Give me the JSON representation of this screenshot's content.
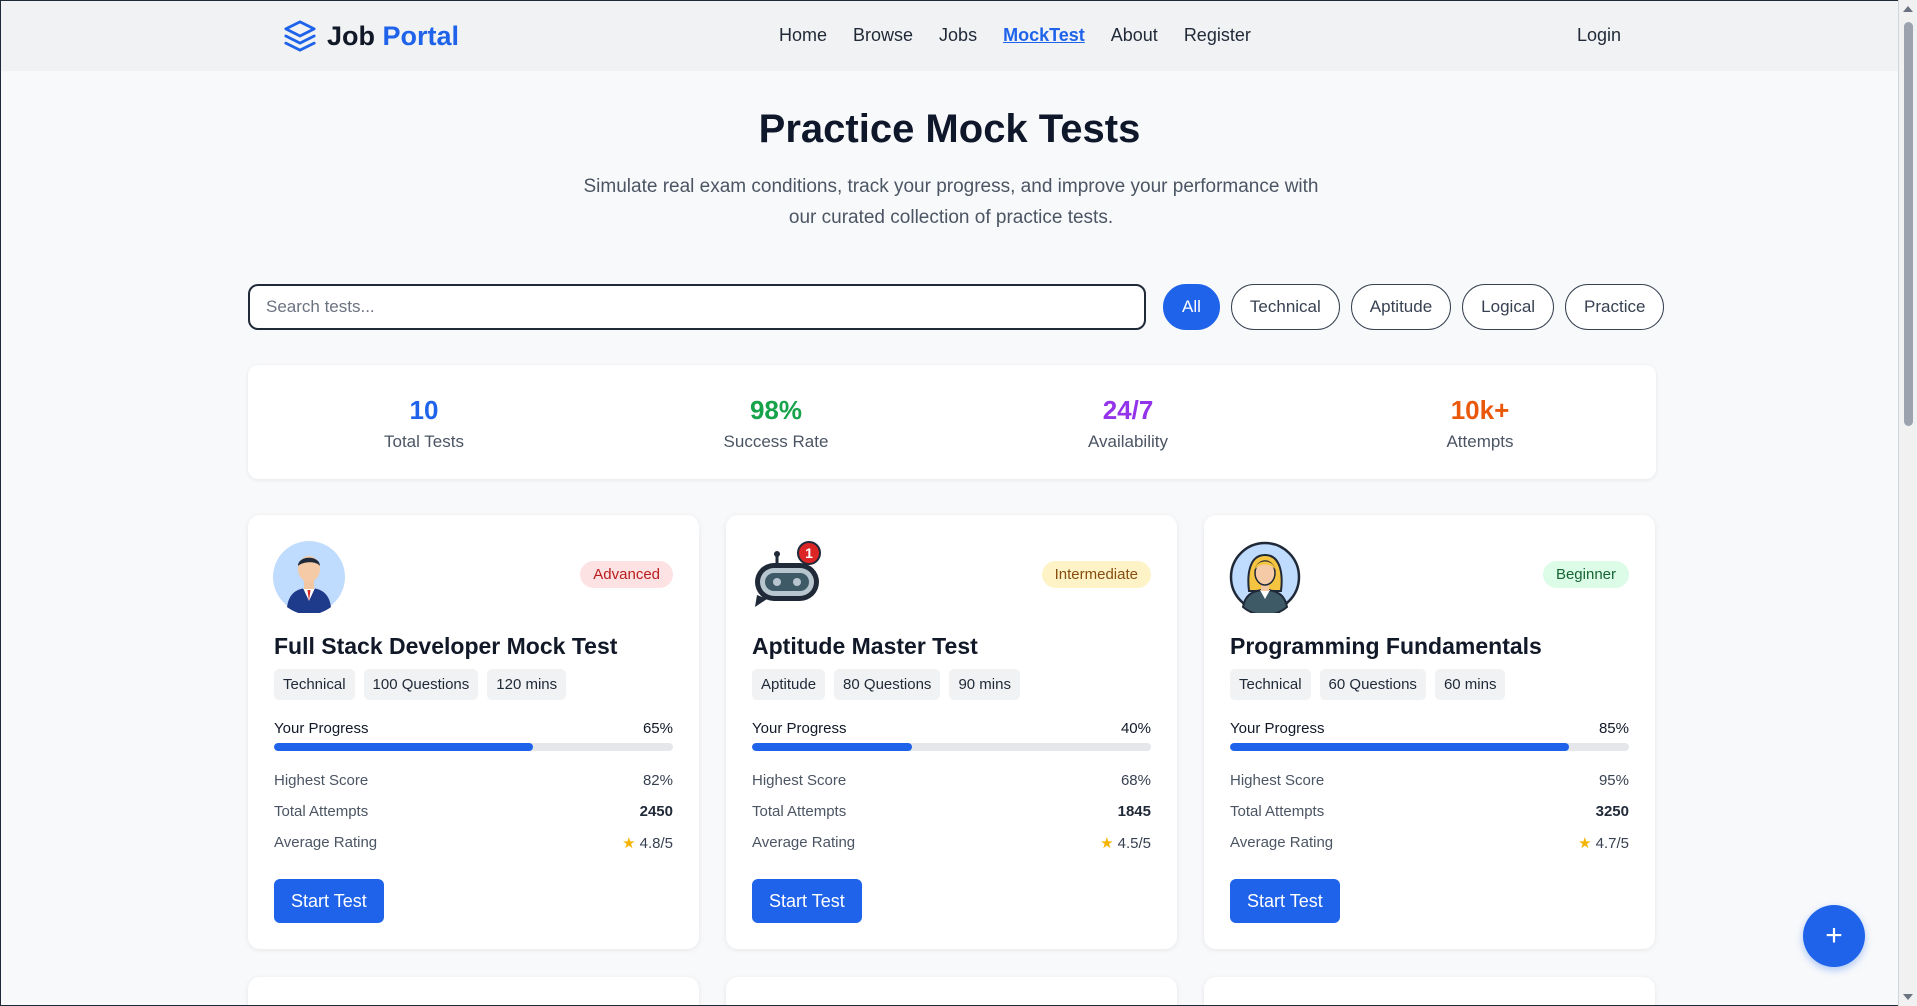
{
  "nav": {
    "brand_main": "Job",
    "brand_accent": "Portal",
    "links": [
      "Home",
      "Browse",
      "Jobs",
      "MockTest",
      "About",
      "Register"
    ],
    "active_link": "MockTest",
    "login": "Login"
  },
  "hero": {
    "title": "Practice Mock Tests",
    "subtitle": "Simulate real exam conditions, track your progress, and improve your performance with our curated collection of practice tests."
  },
  "search": {
    "placeholder": "Search tests..."
  },
  "filters": [
    "All",
    "Technical",
    "Aptitude",
    "Logical",
    "Practice"
  ],
  "active_filter": "All",
  "stats": [
    {
      "value": "10",
      "label": "Total Tests",
      "color": "#1e63e9"
    },
    {
      "value": "98%",
      "label": "Success Rate",
      "color": "#16a34a"
    },
    {
      "value": "24/7",
      "label": "Availability",
      "color": "#9333ea"
    },
    {
      "value": "10k+",
      "label": "Attempts",
      "color": "#ea580c"
    }
  ],
  "cards": [
    {
      "avatar": "businessman-avatar-icon",
      "level": "Advanced",
      "level_bg": "#fde2e4",
      "level_color": "#b91c1c",
      "title": "Full Stack Developer Mock Test",
      "tags": [
        "Technical",
        "100 Questions",
        "120 mins"
      ],
      "progress_label": "Your Progress",
      "progress_text": "65%",
      "progress": 65,
      "highest_label": "Highest Score",
      "highest": "82%",
      "attempts_label": "Total Attempts",
      "attempts": "2450",
      "rating_label": "Average Rating",
      "rating": "4.8/5",
      "button": "Start Test"
    },
    {
      "avatar": "chatbot-notification-icon",
      "badge": "1",
      "level": "Intermediate",
      "level_bg": "#fef3c7",
      "level_color": "#854d0e",
      "title": "Aptitude Master Test",
      "tags": [
        "Aptitude",
        "80 Questions",
        "90 mins"
      ],
      "progress_label": "Your Progress",
      "progress_text": "40%",
      "progress": 40,
      "highest_label": "Highest Score",
      "highest": "68%",
      "attempts_label": "Total Attempts",
      "attempts": "1845",
      "rating_label": "Average Rating",
      "rating": "4.5/5",
      "button": "Start Test"
    },
    {
      "avatar": "businesswoman-avatar-icon",
      "level": "Beginner",
      "level_bg": "#dcfce7",
      "level_color": "#166534",
      "title": "Programming Fundamentals",
      "tags": [
        "Technical",
        "60 Questions",
        "60 mins"
      ],
      "progress_label": "Your Progress",
      "progress_text": "85%",
      "progress": 85,
      "highest_label": "Highest Score",
      "highest": "95%",
      "attempts_label": "Total Attempts",
      "attempts": "3250",
      "rating_label": "Average Rating",
      "rating": "4.7/5",
      "button": "Start Test"
    }
  ],
  "fab": {
    "icon": "plus-icon",
    "label": "+"
  },
  "colors": {
    "accent": "#1e63e9"
  }
}
